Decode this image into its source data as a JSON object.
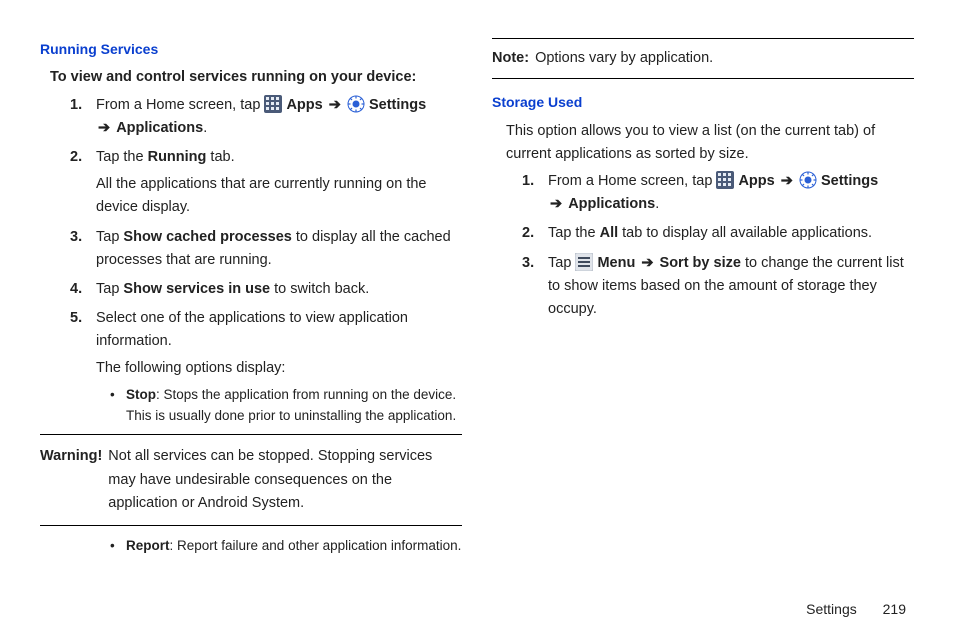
{
  "left": {
    "heading": "Running Services",
    "intro": "To view and control services running on your device:",
    "steps": [
      {
        "num": "1.",
        "pre": "From a Home screen, tap ",
        "apps": "Apps",
        "settings": "Settings",
        "tail_bold": "Applications",
        "tail_end": "."
      },
      {
        "num": "2.",
        "text1": "Tap the ",
        "bold1": "Running",
        "text2": " tab.",
        "extra": "All the applications that are currently running on the device display."
      },
      {
        "num": "3.",
        "text1": "Tap ",
        "bold1": "Show cached processes",
        "text2": " to display all the cached processes that are running."
      },
      {
        "num": "4.",
        "text1": "Tap ",
        "bold1": "Show services in use",
        "text2": " to switch back."
      },
      {
        "num": "5.",
        "line1": "Select one of the applications to view application information.",
        "line2": "The following options display:"
      }
    ],
    "sub_stop_label": "Stop",
    "sub_stop_text": ": Stops the application from running on the device. This is usually done prior to uninstalling the application.",
    "warning_label": "Warning!",
    "warning_text": "Not all services can be stopped. Stopping services may have undesirable consequences on the application or Android System.",
    "sub_report_label": "Report",
    "sub_report_text": ": Report failure and other application information."
  },
  "right": {
    "note_label": "Note:",
    "note_text": "Options vary by application.",
    "heading": "Storage Used",
    "intro": "This option allows you to view a list (on the current tab) of current applications as sorted by size.",
    "steps": [
      {
        "num": "1.",
        "pre": "From a Home screen, tap ",
        "apps": "Apps",
        "settings": "Settings",
        "tail_bold": "Applications",
        "tail_end": "."
      },
      {
        "num": "2.",
        "text1": "Tap the ",
        "bold1": "All",
        "text2": " tab to display all available applications."
      },
      {
        "num": "3.",
        "text1": "Tap ",
        "menu": "Menu",
        "sort": "Sort by size",
        "text2": " to change the current list to show items based on the amount of storage they occupy."
      }
    ]
  },
  "footer": {
    "section": "Settings",
    "page": "219"
  },
  "arrow": "➔"
}
